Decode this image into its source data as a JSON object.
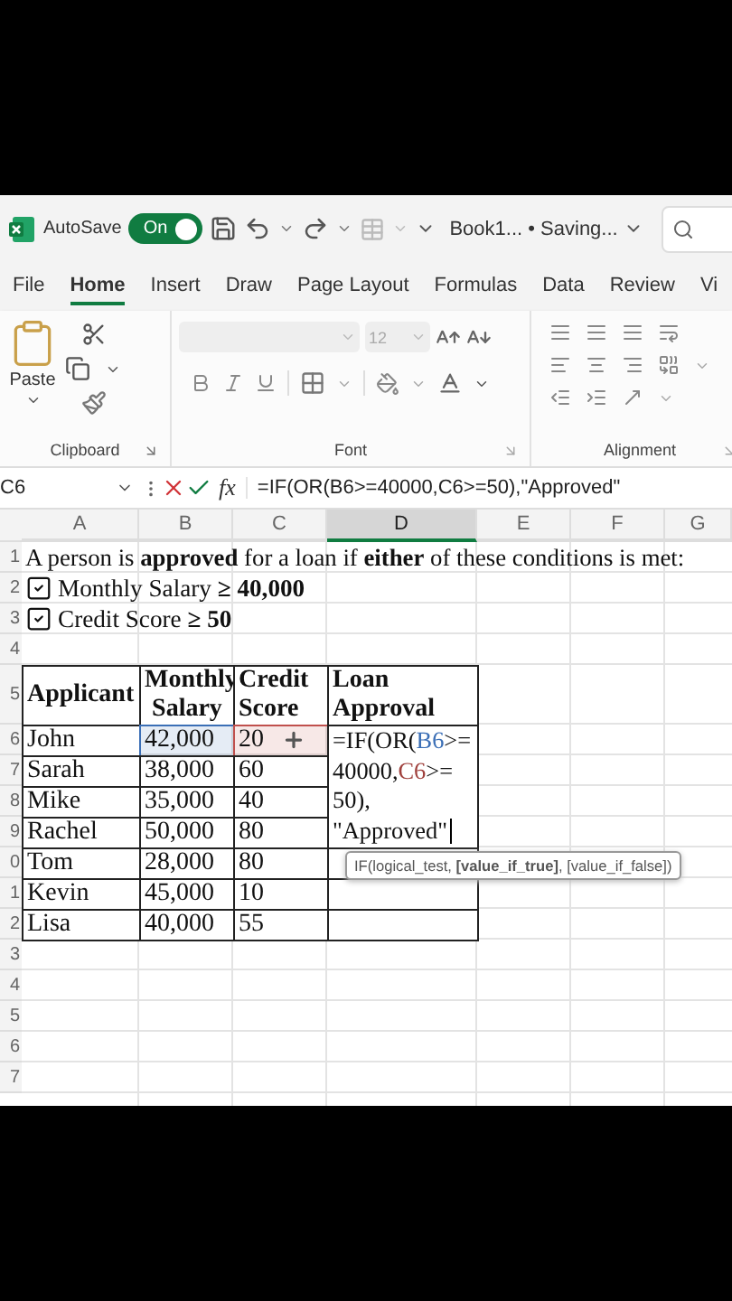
{
  "title_bar": {
    "autosave_label": "AutoSave",
    "autosave": {
      "label": "On",
      "on": true
    },
    "document_title": "Book1... • Saving..."
  },
  "tabs": [
    {
      "label": "File",
      "selected": false
    },
    {
      "label": "Home",
      "selected": true
    },
    {
      "label": "Insert",
      "selected": false
    },
    {
      "label": "Draw",
      "selected": false
    },
    {
      "label": "Page Layout",
      "selected": false
    },
    {
      "label": "Formulas",
      "selected": false
    },
    {
      "label": "Data",
      "selected": false
    },
    {
      "label": "Review",
      "selected": false
    },
    {
      "label": "Vi",
      "selected": false
    }
  ],
  "ribbon": {
    "paste_label": "Paste",
    "font_size": "12",
    "groups": [
      "Clipboard",
      "Font",
      "Alignment"
    ]
  },
  "formula_bar": {
    "name_box": "C6",
    "fx": "fx",
    "formula": "=IF(OR(B6>=40000,C6>=50),\"Approved\""
  },
  "sheet": {
    "columns": [
      {
        "label": "A",
        "selected": false
      },
      {
        "label": "B",
        "selected": false
      },
      {
        "label": "C",
        "selected": false
      },
      {
        "label": "D",
        "selected": true
      },
      {
        "label": "E",
        "selected": false
      },
      {
        "label": "F",
        "selected": false
      },
      {
        "label": "G",
        "selected": false
      }
    ],
    "row_numbers": [
      "1",
      "2",
      "3",
      "4",
      "5",
      "6",
      "7",
      "8",
      "9",
      "0",
      "1",
      "2",
      "3",
      "4",
      "5",
      "6",
      "7"
    ],
    "intro": "A person is **approved** for a loan if **either** of these conditions is met:",
    "conditions": [
      {
        "text": "Monthly Salary **≥ 40,000**",
        "checked": true
      },
      {
        "text": "Credit Score **≥ 50**",
        "checked": true
      }
    ],
    "table": {
      "headers": [
        "Applicant",
        "Monthly Salary",
        "Credit Score",
        "Loan Approval"
      ],
      "rows": [
        {
          "applicant": "John",
          "salary": "42,000",
          "score": "20",
          "salary_ref": {
            "color": "#3b6fb6"
          },
          "score_ref": {
            "color": "#c0504d"
          }
        },
        {
          "applicant": "Sarah",
          "salary": "38,000",
          "score": "60"
        },
        {
          "applicant": "Mike",
          "salary": "35,000",
          "score": "40"
        },
        {
          "applicant": "Rachel",
          "salary": "50,000",
          "score": "80"
        },
        {
          "applicant": "Tom",
          "salary": "28,000",
          "score": "80"
        },
        {
          "applicant": "Kevin",
          "salary": "45,000",
          "score": "10"
        },
        {
          "applicant": "Lisa",
          "salary": "40,000",
          "score": "55"
        }
      ]
    },
    "editor": {
      "lines": [
        [
          {
            "text": "=IF(OR("
          },
          {
            "text": "B6",
            "color": "#3b6fb6"
          },
          {
            "text": ">="
          }
        ],
        [
          {
            "text": "40000,"
          },
          {
            "text": "C6",
            "color": "#a0413d"
          },
          {
            "text": ">="
          }
        ],
        [
          {
            "text": "50),"
          }
        ],
        [
          {
            "text": "\"Approved\""
          }
        ]
      ]
    },
    "tooltip": "IF(logical_test, **[value_if_true]**, [value_if_false])"
  }
}
